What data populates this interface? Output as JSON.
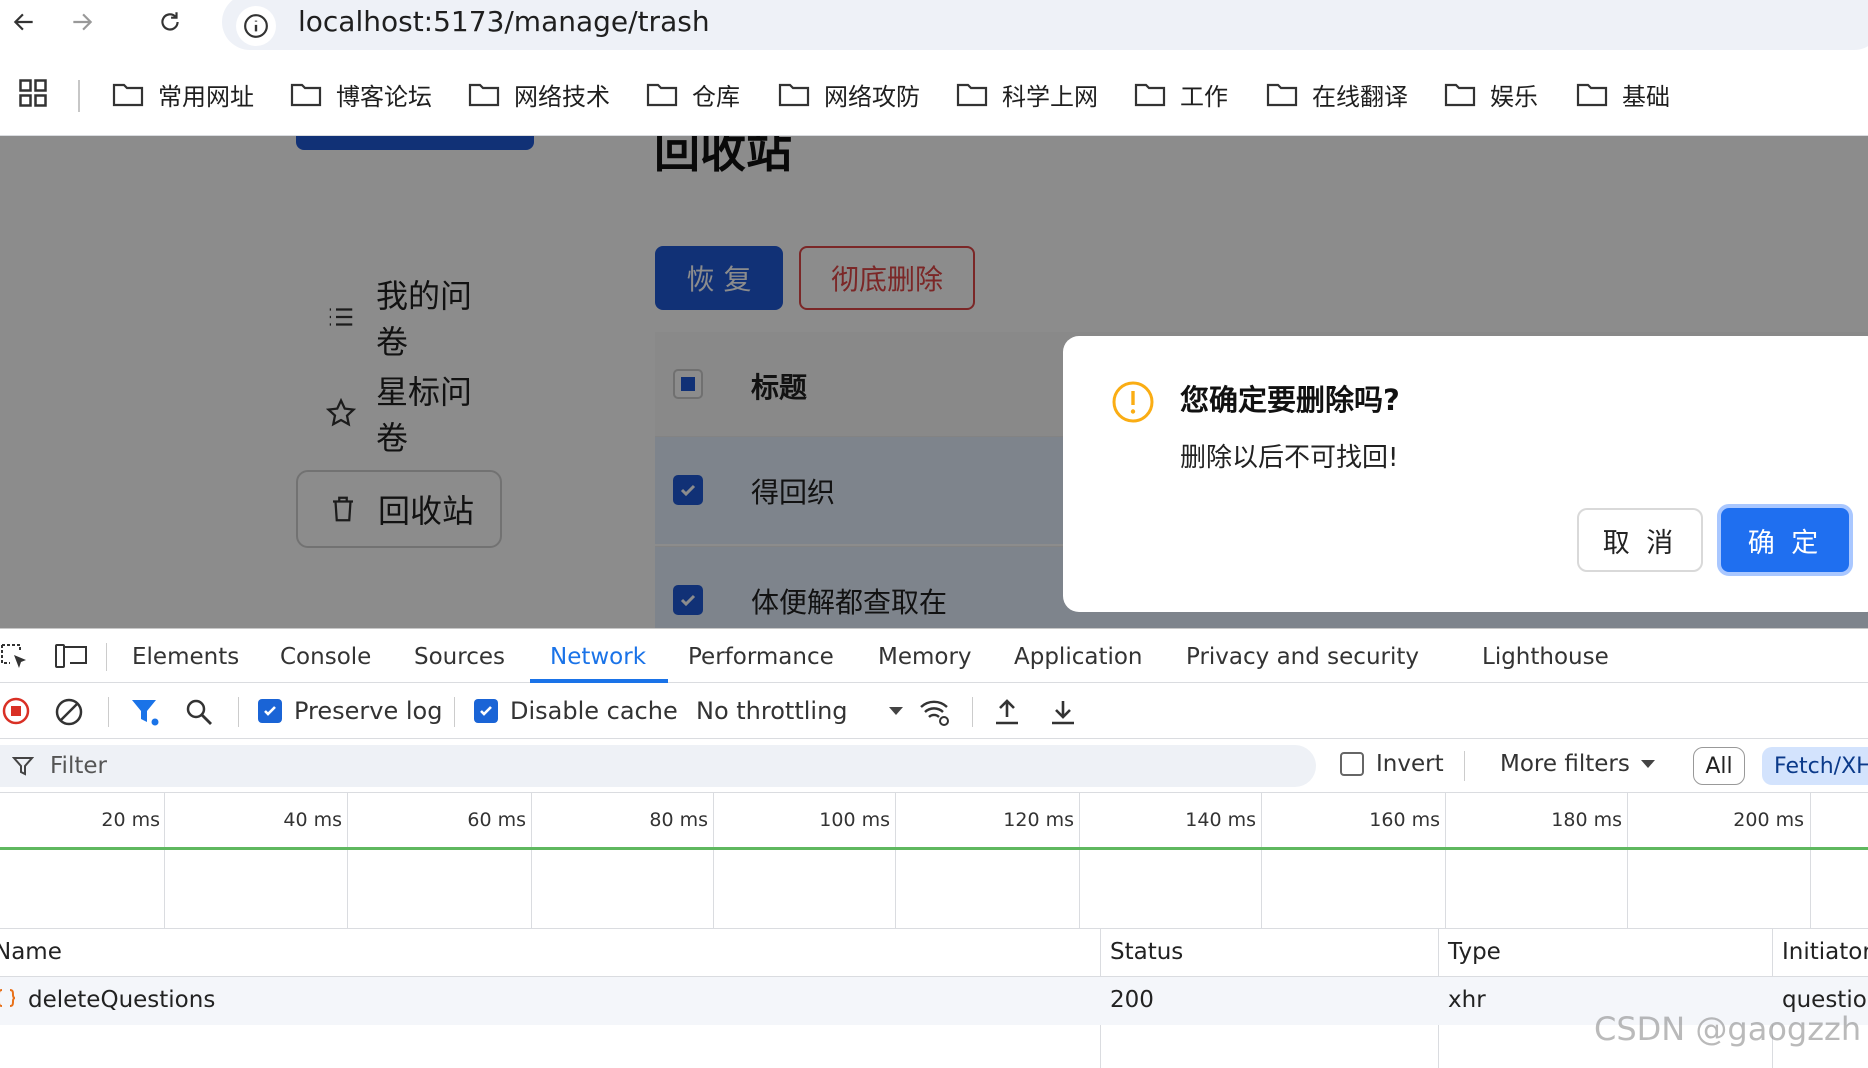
{
  "browser": {
    "url": "localhost:5173/manage/trash",
    "bookmarks": [
      "常用网址",
      "博客论坛",
      "网络技术",
      "仓库",
      "网络攻防",
      "科学上网",
      "工作",
      "在线翻译",
      "娱乐",
      "基础"
    ]
  },
  "page": {
    "title": "回收站",
    "menu": [
      "我的问卷",
      "星标问卷",
      "回收站"
    ],
    "restore_label": "恢 复",
    "purge_label": "彻底删除",
    "table": {
      "header_title": "标题",
      "rows": [
        "得回织",
        "体便解都查取在"
      ]
    }
  },
  "modal": {
    "title": "您确定要删除吗?",
    "content": "删除以后不可找回!",
    "cancel_label": "取 消",
    "ok_label": "确 定"
  },
  "devtools": {
    "tabs": [
      "Elements",
      "Console",
      "Sources",
      "Network",
      "Performance",
      "Memory",
      "Application",
      "Privacy and security",
      "Lighthouse"
    ],
    "active_tab": "Network",
    "preserve_log_label": "Preserve log",
    "preserve_log": true,
    "disable_cache_label": "Disable cache",
    "disable_cache": true,
    "throttling": "No throttling",
    "filter_placeholder": "Filter",
    "invert_label": "Invert",
    "more_filters_label": "More filters",
    "chip_all": "All",
    "chip_fetch": "Fetch/XHR",
    "ticks": [
      "20 ms",
      "40 ms",
      "60 ms",
      "80 ms",
      "100 ms",
      "120 ms",
      "140 ms",
      "160 ms",
      "180 ms",
      "200 ms"
    ],
    "columns": [
      "Name",
      "Status",
      "Type",
      "Initiator"
    ],
    "requests": [
      {
        "name": "deleteQuestions",
        "status": "200",
        "type": "xhr",
        "initiator": "questio"
      }
    ]
  },
  "watermark": "CSDN @gaogzzh",
  "colors": {
    "primary": "#1f5ad8",
    "danger": "#e04848",
    "devtools_accent": "#1a73e8",
    "warning": "#faad14"
  }
}
